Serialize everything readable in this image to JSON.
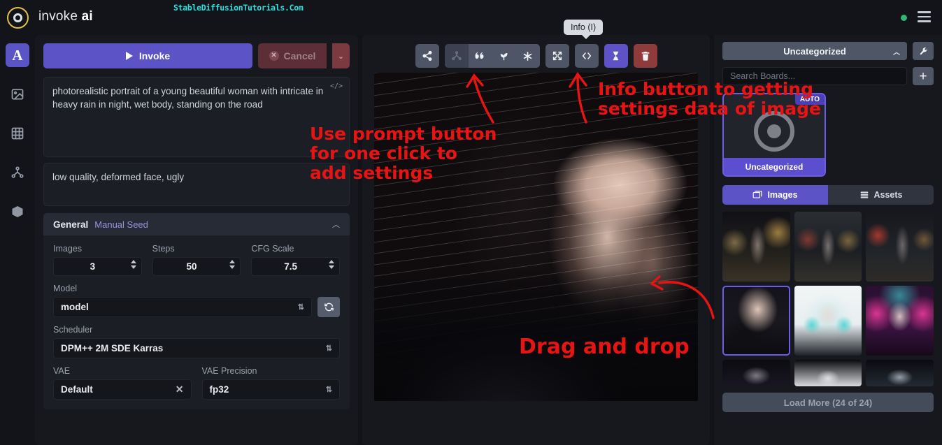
{
  "app": {
    "brand_first": "invoke",
    "brand_second": "ai",
    "watermark": "StableDiffusionTutorials.Com"
  },
  "rail": {
    "items": [
      {
        "name": "text-to-image",
        "glyph": "A"
      },
      {
        "name": "image-to-image",
        "glyph": "image"
      },
      {
        "name": "unified-canvas",
        "glyph": "grid"
      },
      {
        "name": "node-editor",
        "glyph": "nodes"
      },
      {
        "name": "model-manager",
        "glyph": "cube"
      }
    ]
  },
  "left_panel": {
    "invoke_label": "Invoke",
    "cancel_label": "Cancel",
    "positive_prompt": "photorealistic portrait of a young beautiful woman with intricate in heavy rain in night, wet body, standing on the road",
    "negative_prompt": "low quality, deformed face, ugly",
    "accordion": {
      "title": "General",
      "subtitle": "Manual Seed"
    },
    "fields": {
      "images_label": "Images",
      "images_value": "3",
      "steps_label": "Steps",
      "steps_value": "50",
      "cfg_label": "CFG Scale",
      "cfg_value": "7.5",
      "model_label": "Model",
      "model_value": "model",
      "scheduler_label": "Scheduler",
      "scheduler_value": "DPM++ 2M SDE Karras",
      "vae_label": "VAE",
      "vae_value": "Default",
      "vae_precision_label": "VAE Precision",
      "vae_precision_value": "fp32"
    }
  },
  "viewer": {
    "tooltip": "Info (I)",
    "toolbar": [
      {
        "name": "send-to-button",
        "icon": "share-icon"
      },
      {
        "name": "use-workflow-button",
        "icon": "nodes-icon"
      },
      {
        "name": "use-prompt-button",
        "icon": "quote-icon"
      },
      {
        "name": "use-seed-button",
        "icon": "sprout-icon"
      },
      {
        "name": "use-all-parameters-button",
        "icon": "asterisk-icon"
      },
      {
        "name": "use-size-button",
        "icon": "expand-icon"
      },
      {
        "name": "info-button",
        "icon": "code-icon"
      },
      {
        "name": "queue-button",
        "icon": "hourglass-icon"
      },
      {
        "name": "delete-button",
        "icon": "trash-icon"
      }
    ]
  },
  "right_panel": {
    "board_selected": "Uncategorized",
    "search_placeholder": "Search Boards...",
    "add_board_label": "+",
    "board_card": {
      "badge": "AUTO",
      "name": "Uncategorized"
    },
    "tabs": [
      {
        "label": "Images",
        "active": true
      },
      {
        "label": "Assets",
        "active": false
      }
    ],
    "load_more_label": "Load More (24 of 24)",
    "gallery": [
      {
        "name": "gallery-image-1",
        "selected": false
      },
      {
        "name": "gallery-image-2",
        "selected": false
      },
      {
        "name": "gallery-image-3",
        "selected": false
      },
      {
        "name": "gallery-image-4",
        "selected": true
      },
      {
        "name": "gallery-image-5",
        "selected": false
      },
      {
        "name": "gallery-image-6",
        "selected": false
      },
      {
        "name": "gallery-image-7",
        "selected": false
      },
      {
        "name": "gallery-image-8",
        "selected": false
      },
      {
        "name": "gallery-image-9",
        "selected": false
      }
    ]
  },
  "annotations": {
    "prompt_note": "Use prompt button for one click to add settings",
    "info_note": "Info button to getting settings data of image",
    "drag_note": "Drag and drop"
  },
  "colors": {
    "accent_purple": "#5b53c6",
    "brand_gold": "#e2c044",
    "danger_red": "#8f3b3b",
    "annotation_red": "#e81414",
    "status_green": "#2eb872",
    "watermark_cyan": "#2ce0e0"
  }
}
